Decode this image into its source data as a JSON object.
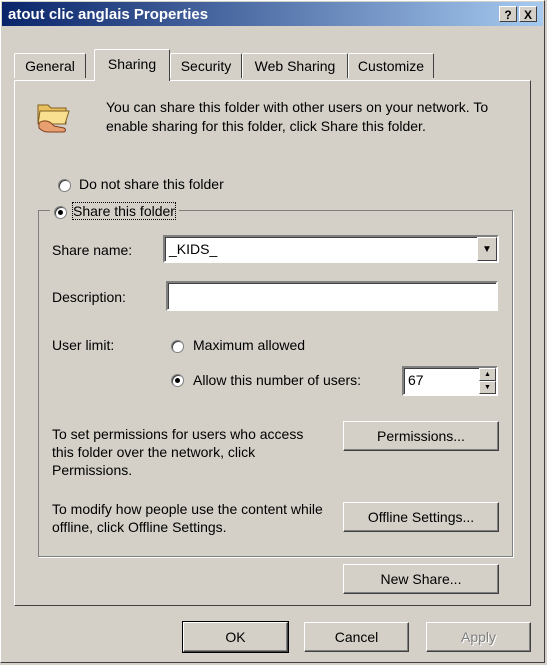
{
  "window": {
    "title": "atout clic anglais Properties",
    "help_label": "?",
    "close_label": "X"
  },
  "tabs": [
    {
      "label": "General"
    },
    {
      "label": "Sharing"
    },
    {
      "label": "Security"
    },
    {
      "label": "Web Sharing"
    },
    {
      "label": "Customize"
    }
  ],
  "intro": {
    "icon": "shared-folder-icon",
    "text": "You can share this folder with other users on your network.  To enable sharing for this folder, click Share this folder."
  },
  "sharing": {
    "not_share_label": "Do not share this folder",
    "share_label": "Share this folder",
    "selected": "share"
  },
  "share_name": {
    "label": "Share name:",
    "value": "_KIDS_"
  },
  "description": {
    "label": "Description:",
    "value": ""
  },
  "user_limit": {
    "label": "User limit:",
    "max_label": "Maximum allowed",
    "allow_label": "Allow this number of users:",
    "value": "67",
    "selected": "allow"
  },
  "permissions": {
    "text": "To set permissions for users who access this folder over the network, click Permissions.",
    "button": "Permissions..."
  },
  "offline": {
    "text": "To modify how people use the content while offline, click Offline Settings.",
    "button": "Offline Settings..."
  },
  "new_share_button": "New Share...",
  "footer": {
    "ok": "OK",
    "cancel": "Cancel",
    "apply": "Apply"
  }
}
